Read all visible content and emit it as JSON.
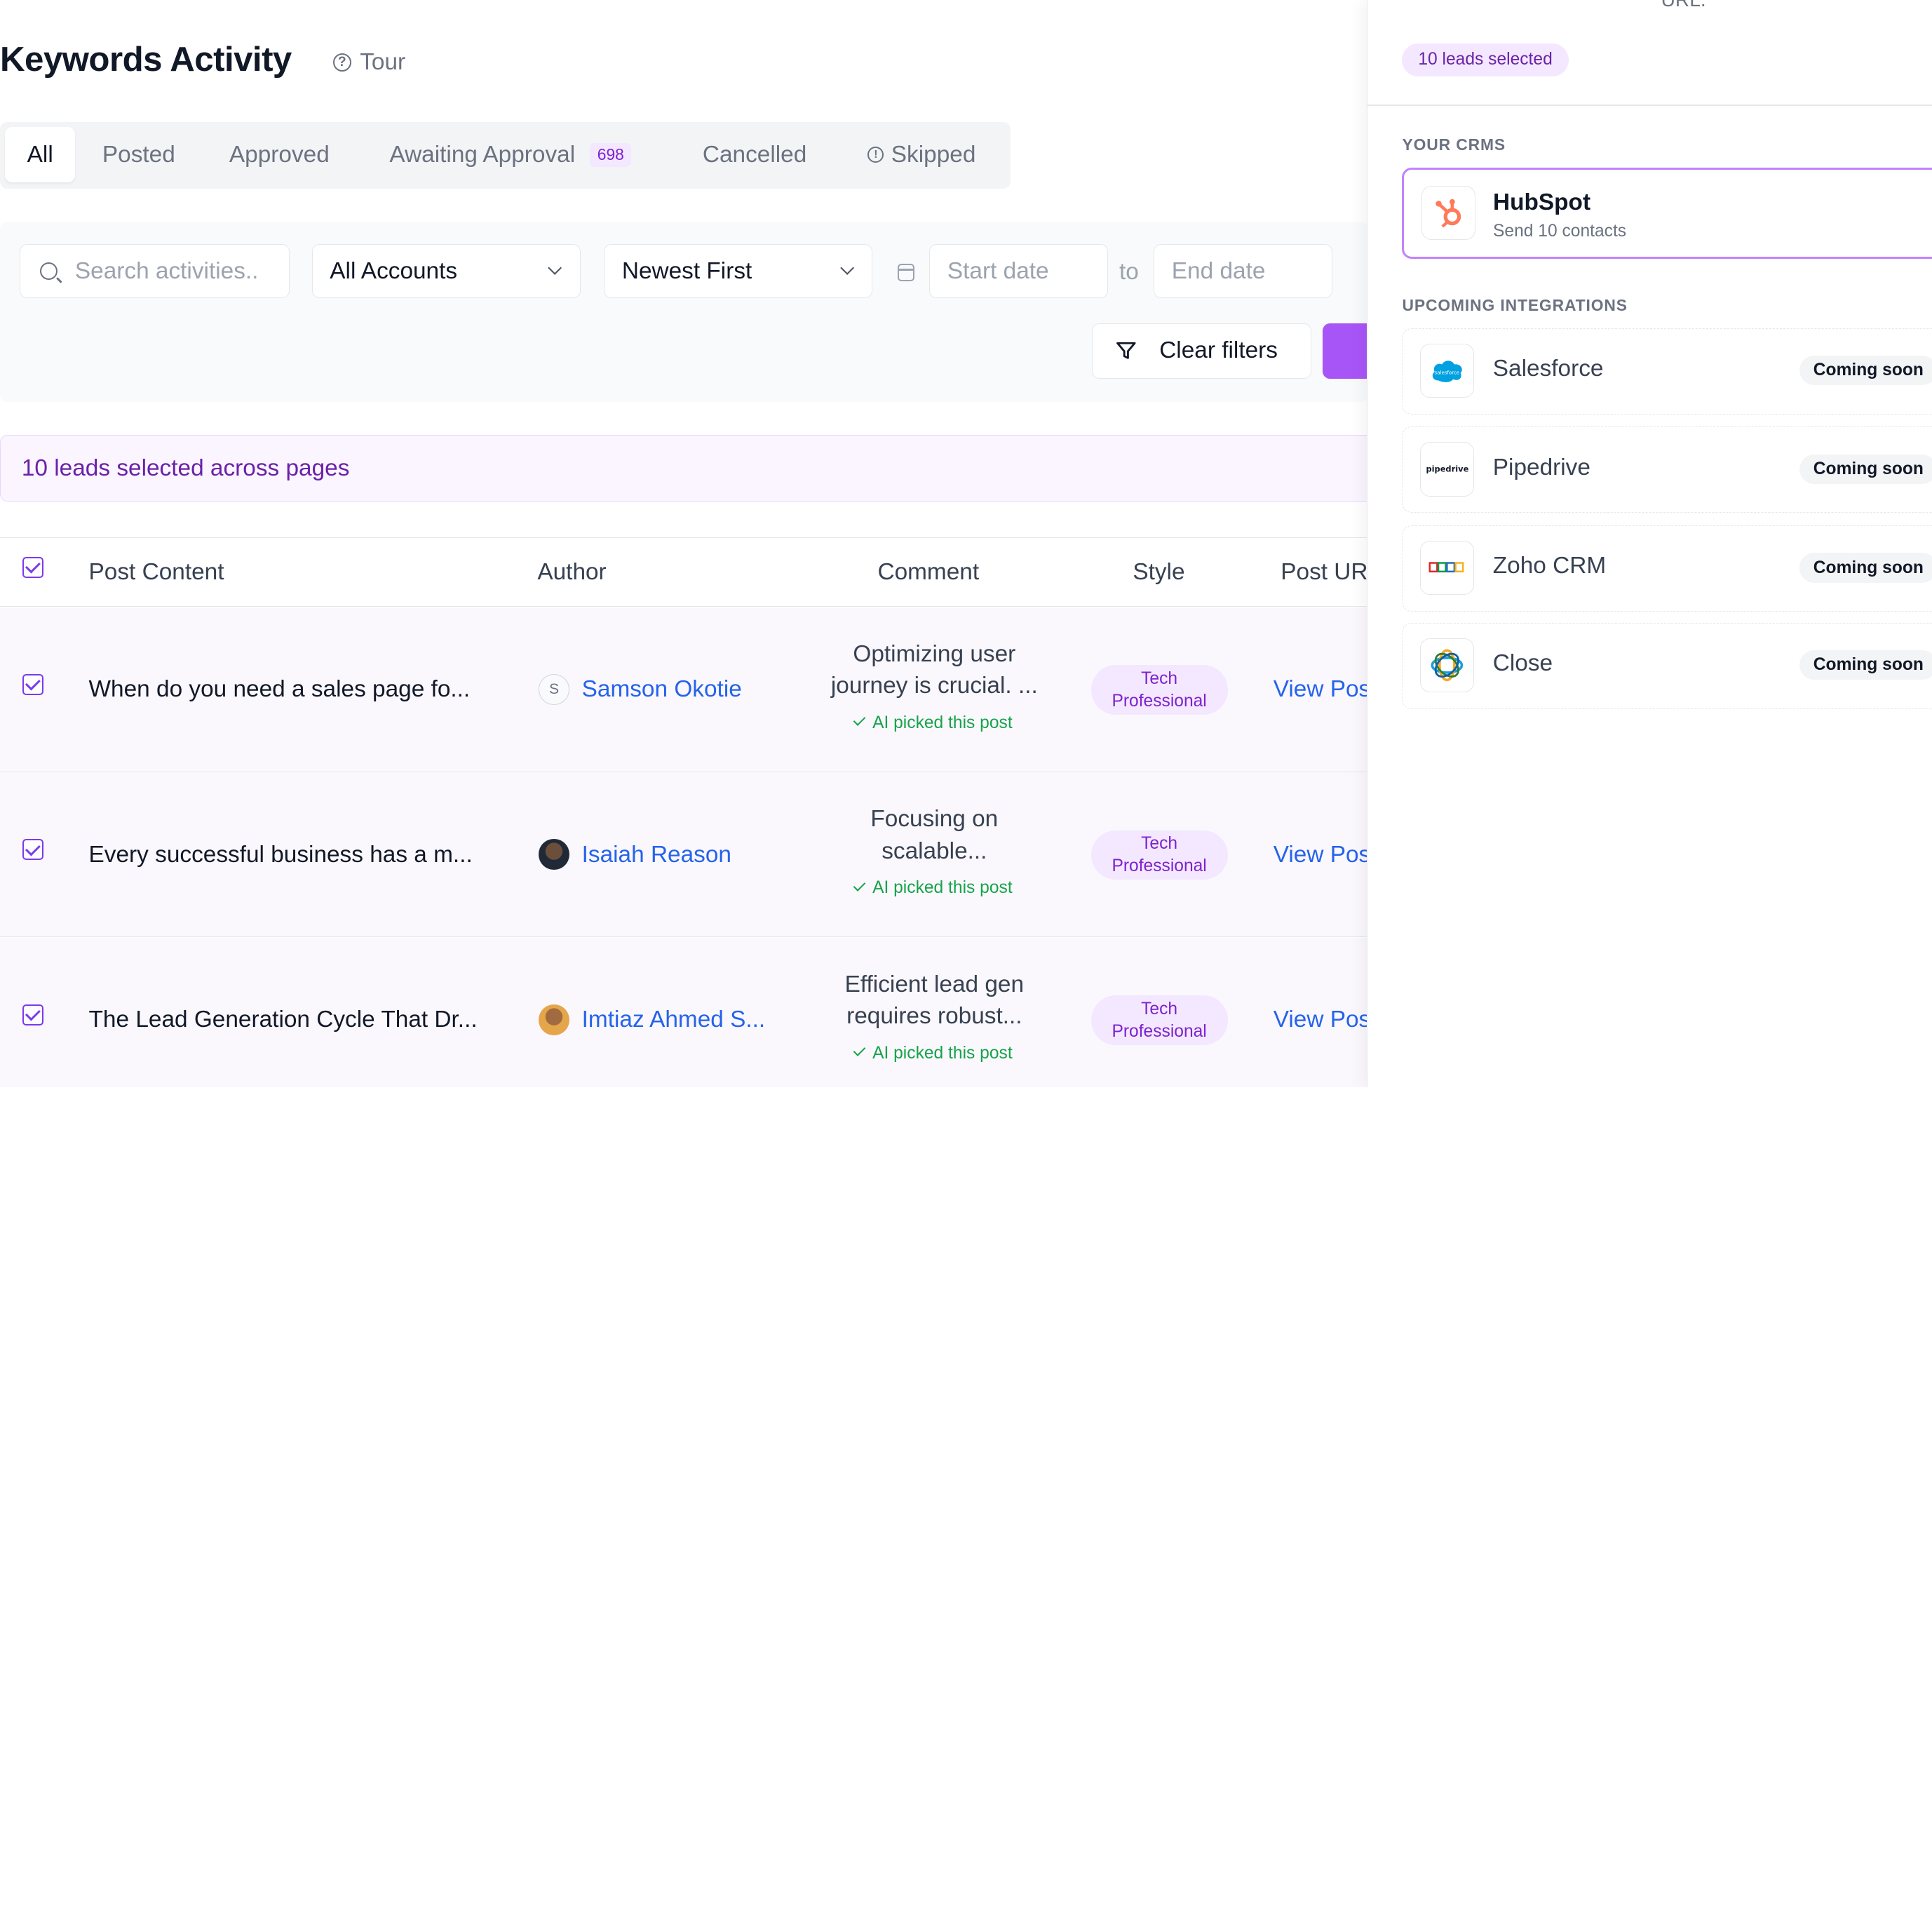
{
  "header": {
    "title": "Keywords Activity",
    "tour_label": "Tour"
  },
  "tabs": [
    {
      "label": "All",
      "active": true
    },
    {
      "label": "Posted"
    },
    {
      "label": "Approved"
    },
    {
      "label": "Awaiting Approval",
      "count": "698"
    },
    {
      "label": "Cancelled"
    },
    {
      "label": "Skipped",
      "icon": "info-icon"
    }
  ],
  "filters": {
    "search_placeholder": "Search activities..",
    "accounts_value": "All Accounts",
    "sort_value": "Newest First",
    "start_placeholder": "Start date",
    "to_label": "to",
    "end_placeholder": "End date",
    "clear_label": "Clear filters"
  },
  "selection_banner": "10 leads selected across pages",
  "table": {
    "headers": [
      "Post Content",
      "Author",
      "Comment",
      "Style",
      "Post URL"
    ],
    "rows": [
      {
        "post": "When do you need a sales page fo...",
        "author": "Samson Okotie",
        "avatar_initial": "S",
        "comment_line1": "Optimizing user",
        "comment_line2": "journey is crucial. ...",
        "ai_note": "AI picked this post",
        "style_line1": "Tech",
        "style_line2": "Professional",
        "link": "View Post"
      },
      {
        "post": "Every successful business has a m...",
        "author": "Isaiah Reason",
        "avatar_initial": "",
        "comment_line1": "Focusing on",
        "comment_line2": "scalable...",
        "ai_note": "AI picked this post",
        "style_line1": "Tech",
        "style_line2": "Professional",
        "link": "View Post"
      },
      {
        "post": "The Lead Generation Cycle That Dr...",
        "author": "Imtiaz Ahmed S...",
        "avatar_initial": "",
        "comment_line1": "Efficient lead gen",
        "comment_line2": "requires robust...",
        "ai_note": "AI picked this post",
        "style_line1": "Tech",
        "style_line2": "Professional",
        "link": "View Post"
      }
    ]
  },
  "panel": {
    "top_text": "URL.",
    "leads_selected": "10 leads selected",
    "crms_heading": "YOUR CRMS",
    "hubspot": {
      "name": "HubSpot",
      "subtitle": "Send 10 contacts"
    },
    "upcoming_heading": "UPCOMING INTEGRATIONS",
    "integrations": [
      {
        "name": "Salesforce",
        "status": "Coming soon",
        "icon": "salesforce-icon"
      },
      {
        "name": "Pipedrive",
        "status": "Coming soon",
        "icon": "pipedrive-icon"
      },
      {
        "name": "Zoho CRM",
        "status": "Coming soon",
        "icon": "zoho-icon"
      },
      {
        "name": "Close",
        "status": "Coming soon",
        "icon": "close-crm-icon"
      }
    ]
  },
  "colors": {
    "accent": "#a855f7",
    "link": "#2563eb",
    "ai_green": "#16a34a",
    "hubspot_orange": "#ff7a59",
    "salesforce_blue": "#00a1e0"
  }
}
